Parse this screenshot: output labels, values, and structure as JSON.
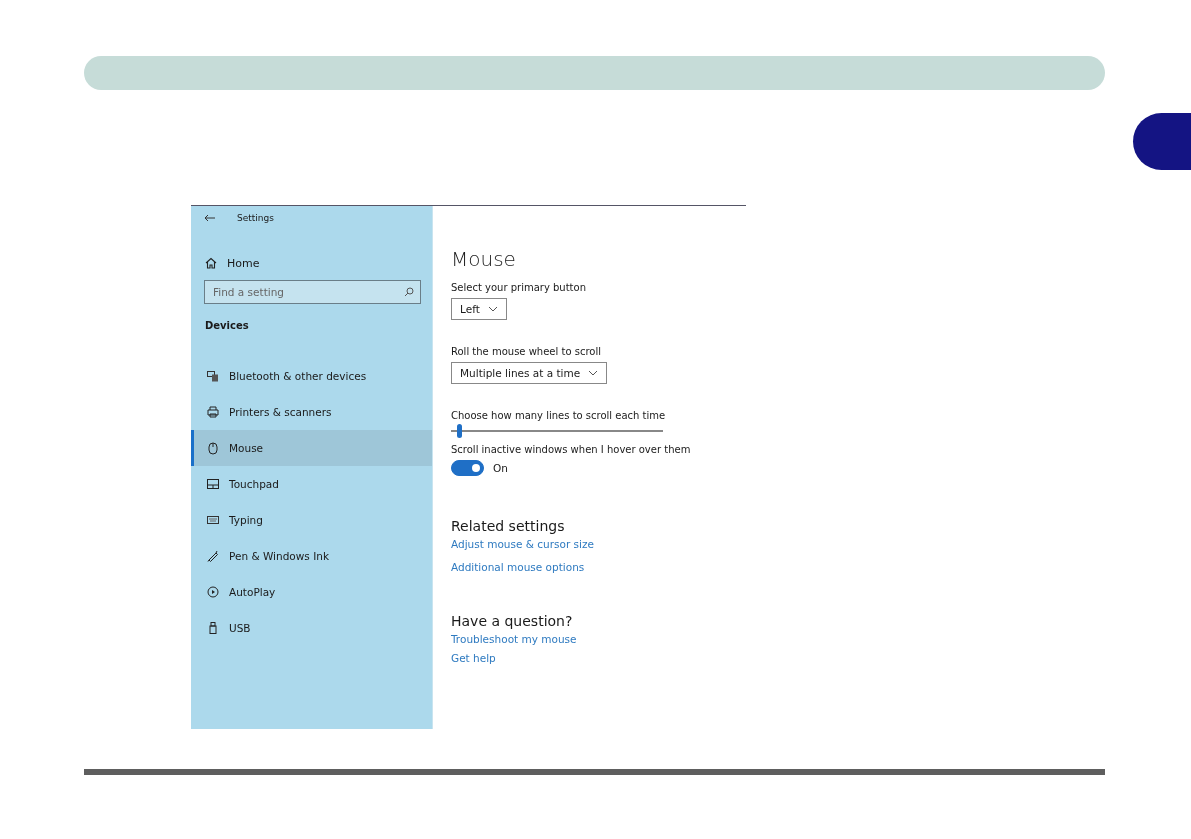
{
  "window": {
    "title": "Settings"
  },
  "sidebar": {
    "home": "Home",
    "search": {
      "placeholder": "Find a setting"
    },
    "section": "Devices",
    "items": [
      {
        "label": "Bluetooth & other devices",
        "selected": false
      },
      {
        "label": "Printers & scanners",
        "selected": false
      },
      {
        "label": "Mouse",
        "selected": true
      },
      {
        "label": "Touchpad",
        "selected": false
      },
      {
        "label": "Typing",
        "selected": false
      },
      {
        "label": "Pen & Windows Ink",
        "selected": false
      },
      {
        "label": "AutoPlay",
        "selected": false
      },
      {
        "label": "USB",
        "selected": false
      }
    ]
  },
  "content": {
    "title": "Mouse",
    "settings": [
      {
        "kind": "dropdown",
        "label": "Select your primary button",
        "value": "Left"
      },
      {
        "kind": "dropdown",
        "label": "Roll the mouse wheel to scroll",
        "value": "Multiple lines at a time"
      },
      {
        "kind": "slider",
        "label": "Choose how many lines to scroll each time",
        "level": 0.03
      },
      {
        "kind": "toggle",
        "label": "Scroll inactive windows when I hover over them",
        "on": true,
        "state_text": "On"
      }
    ],
    "sections": [
      {
        "heading": "Related settings",
        "links": [
          "Adjust mouse & cursor size",
          "Additional mouse options"
        ]
      },
      {
        "heading": "Have a question?",
        "links": [
          "Troubleshoot my mouse",
          "Get help"
        ]
      }
    ]
  }
}
